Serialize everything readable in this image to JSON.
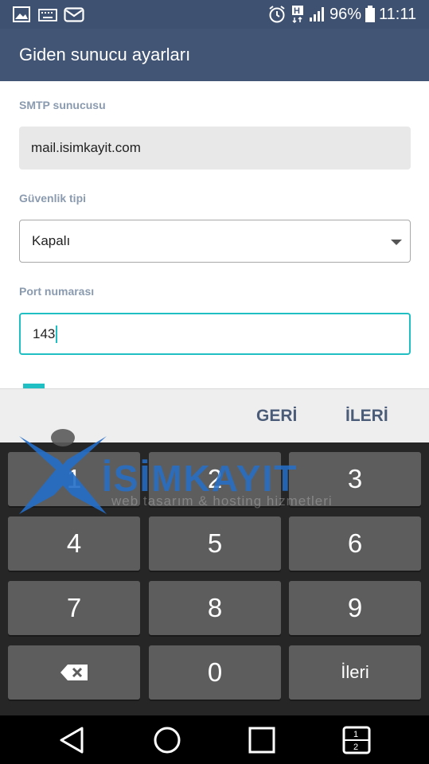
{
  "status_bar": {
    "battery": "96%",
    "time": "11:11",
    "left_icons": [
      "image-icon",
      "keyboard-icon",
      "email-icon"
    ],
    "right_icons": [
      "alarm-icon",
      "hplus-icon",
      "signal-icon",
      "battery-icon"
    ]
  },
  "app_bar": {
    "title": "Giden sunucu ayarları"
  },
  "form": {
    "smtp_label": "SMTP sunucusu",
    "smtp_value": "mail.isimkayit.com",
    "security_label": "Güvenlik tipi",
    "security_value": "Kapalı",
    "port_label": "Port numarası",
    "port_value": "143"
  },
  "actions": {
    "back": "GERİ",
    "next": "İLERİ"
  },
  "keypad": {
    "keys": [
      "1",
      "2",
      "3",
      "4",
      "5",
      "6",
      "7",
      "8",
      "9",
      "0"
    ],
    "enter": "İleri",
    "backspace_icon": "backspace-icon"
  },
  "watermark": {
    "text": "İSİMKAYIT",
    "subtitle": "web tasarım & hosting hizmetleri"
  },
  "nav_bar": {
    "icons": [
      "back-icon",
      "home-icon",
      "recents-icon",
      "dual-window-icon"
    ]
  },
  "colors": {
    "app_bar": "#435574",
    "accent": "#1fbfc3",
    "action_text": "#4b5c78",
    "keypad_bg": "#262626"
  }
}
